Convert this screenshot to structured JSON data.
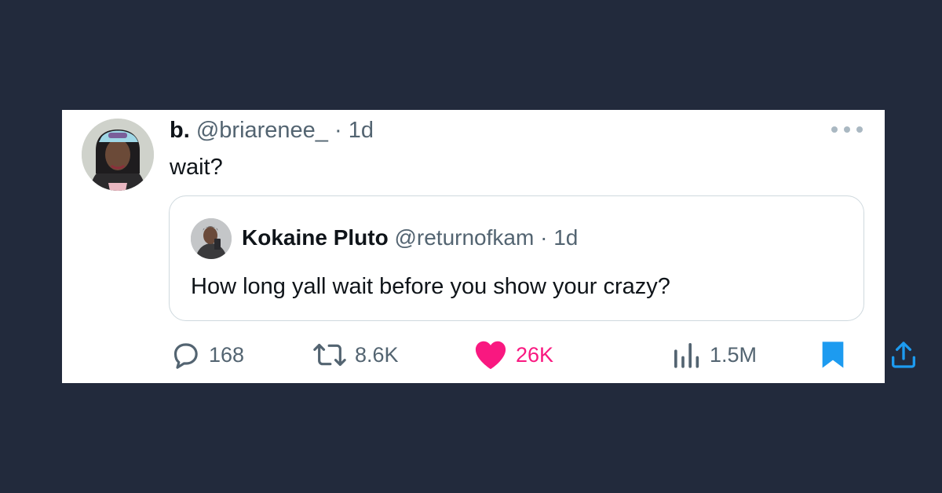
{
  "tweet": {
    "author": {
      "display_name": "b.",
      "handle": "@briarenee_",
      "separator": "·",
      "time": "1d"
    },
    "text": "wait?",
    "more_icon": "more-horizontal-icon"
  },
  "quote": {
    "author": {
      "display_name": "Kokaine Pluto",
      "handle": "@returnofkam",
      "separator": "·",
      "time": "1d"
    },
    "text": "How long yall wait before you show your crazy?"
  },
  "actions": {
    "replies": {
      "icon": "reply-icon",
      "count": "168"
    },
    "retweets": {
      "icon": "retweet-icon",
      "count": "8.6K"
    },
    "likes": {
      "icon": "heart-icon",
      "count": "26K",
      "color": "#f91880",
      "liked": true
    },
    "views": {
      "icon": "views-icon",
      "count": "1.5M"
    },
    "bookmark": {
      "icon": "bookmark-icon",
      "color": "#1d9bf0",
      "bookmarked": true
    },
    "share": {
      "icon": "share-icon",
      "color": "#1d9bf0"
    }
  },
  "colors": {
    "background": "#222a3c",
    "card": "#ffffff",
    "text": "#0f1419",
    "muted": "#536471",
    "like": "#f91880",
    "accent": "#1d9bf0"
  }
}
